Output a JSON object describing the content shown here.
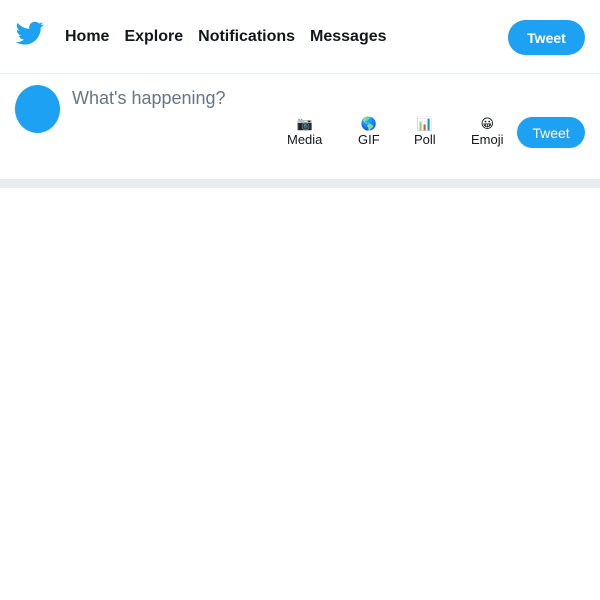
{
  "nav": {
    "items": [
      "Home",
      "Explore",
      "Notifications",
      "Messages"
    ],
    "tweet_label": "Tweet"
  },
  "composer": {
    "placeholder": "What's happening?",
    "tools": [
      {
        "icon": "camera-icon",
        "glyph": "📷",
        "label": "Media"
      },
      {
        "icon": "globe-icon",
        "glyph": "🌎",
        "label": "GIF"
      },
      {
        "icon": "bar-chart-icon",
        "glyph": "📊",
        "label": "Poll"
      },
      {
        "icon": "smiley-icon",
        "glyph": "😀",
        "label": "Emoji"
      }
    ],
    "tweet_label": "Tweet"
  },
  "colors": {
    "accent": "#1da1f2",
    "divider": "#e6ecf0",
    "placeholder": "#657786"
  }
}
